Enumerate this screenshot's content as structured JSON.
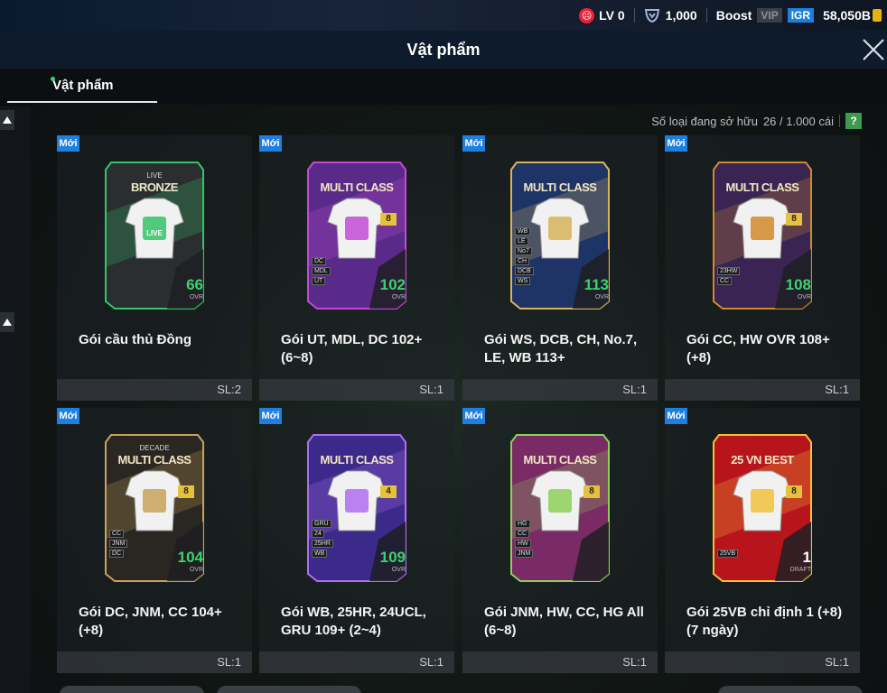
{
  "topbar": {
    "level": "LV 0",
    "coins": "1,000",
    "boost_label": "Boost",
    "vip_label": "VIP",
    "igr_label": "IGR",
    "balance": "58,050B"
  },
  "window": {
    "title": "Vật phẩm"
  },
  "tabs": [
    {
      "label": "Vật phẩm",
      "active": true
    }
  ],
  "inventory": {
    "owned_label": "Số loại đang sở hữu",
    "owned_value": "26 / 1.000 cái",
    "help_label": "?"
  },
  "items": [
    {
      "badge": "Mới",
      "name": "Gói cầu thủ Đồng",
      "qty": "SL:2",
      "card_title_top": "LIVE",
      "card_title": "BRONZE",
      "ovr": "66",
      "ovr_label": "OVR",
      "jersey": "LIVE",
      "colors": {
        "bg": "#2b2e31",
        "accent": "#34c46a"
      }
    },
    {
      "badge": "Mới",
      "name": "Gói UT, MDL, DC 102+ (6~8)",
      "qty": "SL:1",
      "card_title": "MULTI CLASS",
      "ovr": "102",
      "ovr_label": "OVR",
      "level": "8",
      "positions": [
        "DC",
        "MDL",
        "UT"
      ],
      "colors": {
        "bg": "#5a2a8a",
        "accent": "#c24bd6"
      }
    },
    {
      "badge": "Mới",
      "name": "Gói WS, DCB, CH, No.7, LE, WB 113+",
      "qty": "SL:1",
      "card_title": "MULTI CLASS",
      "ovr": "113",
      "ovr_label": "OVR",
      "positions": [
        "WB",
        "LE",
        "No7",
        "CH",
        "DCB",
        "WS"
      ],
      "colors": {
        "bg": "#1e3366",
        "accent": "#d7b45c"
      }
    },
    {
      "badge": "Mới",
      "name": "Gói CC, HW OVR 108+ (+8)",
      "qty": "SL:1",
      "card_title": "MULTI CLASS",
      "ovr": "108",
      "ovr_label": "OVR",
      "level": "8",
      "positions": [
        "23HW",
        "CC"
      ],
      "colors": {
        "bg": "#3a2453",
        "accent": "#d28a2a"
      }
    },
    {
      "badge": "Mới",
      "name": "Gói DC, JNM, CC 104+ (+8)",
      "qty": "SL:1",
      "card_title_top": "DECADE",
      "card_title": "MULTI CLASS",
      "ovr": "104",
      "ovr_label": "OVR",
      "level": "8",
      "positions": [
        "CC",
        "JNM",
        "DC"
      ],
      "colors": {
        "bg": "#2a2622",
        "accent": "#c9a35a"
      }
    },
    {
      "badge": "Mới",
      "name": "Gói WB, 25HR, 24UCL, GRU 109+ (2~4)",
      "qty": "SL:1",
      "card_title": "MULTI CLASS",
      "ovr": "109",
      "ovr_label": "OVR",
      "level": "4",
      "positions": [
        "GRU",
        "24",
        "25HR",
        "WB"
      ],
      "colors": {
        "bg": "#3b2a8a",
        "accent": "#b06ef0"
      }
    },
    {
      "badge": "Mới",
      "name": "Gói JNM, HW, CC, HG All (6~8)",
      "qty": "SL:1",
      "card_title": "MULTI CLASS",
      "ovr": "",
      "level": "8",
      "positions": [
        "HG",
        "CC",
        "HW",
        "JNM"
      ],
      "colors": {
        "bg": "#7a2a64",
        "accent": "#8ed05a"
      }
    },
    {
      "badge": "Mới",
      "name": "Gói 25VB chỉ định 1 (+8) (7 ngày)",
      "qty": "SL:1",
      "card_title": "25 VN BEST",
      "ovr": "1",
      "ovr_label": "DRAFT",
      "level": "8",
      "positions": [
        "25VB"
      ],
      "colors": {
        "bg": "#b8141c",
        "accent": "#f2c23c"
      }
    }
  ]
}
